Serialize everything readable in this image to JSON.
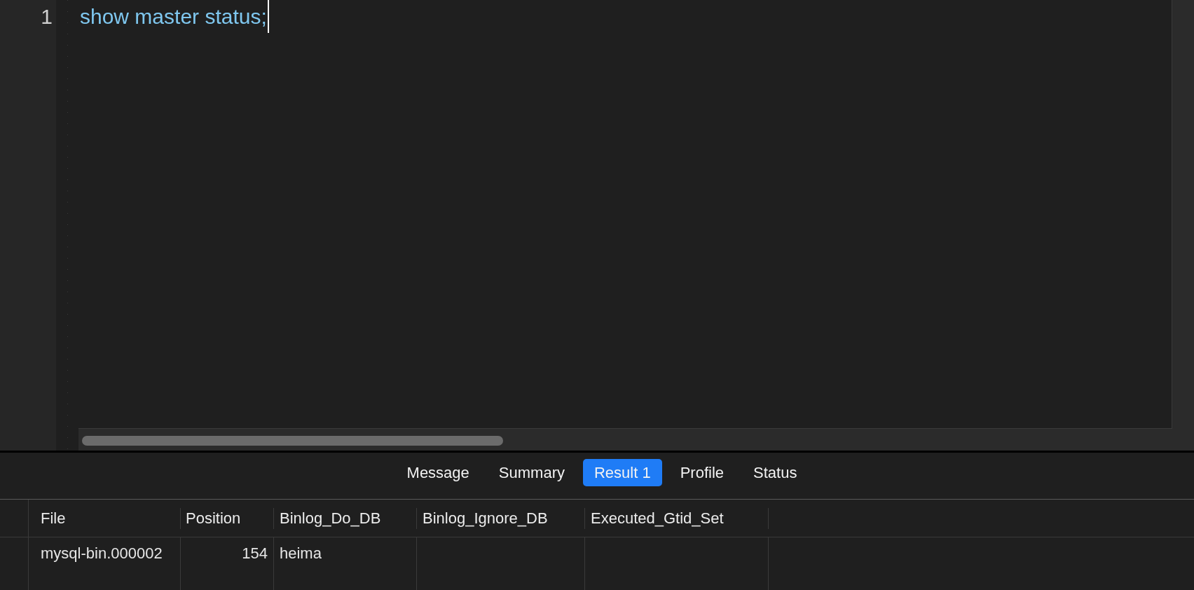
{
  "editor": {
    "lines": [
      {
        "number": "1",
        "code": "show master status;",
        "cursor": true
      }
    ]
  },
  "result_tabs": [
    {
      "label": "Message",
      "selected": false
    },
    {
      "label": "Summary",
      "selected": false
    },
    {
      "label": "Result 1",
      "selected": true
    },
    {
      "label": "Profile",
      "selected": false
    },
    {
      "label": "Status",
      "selected": false
    }
  ],
  "result_table": {
    "columns": [
      "File",
      "Position",
      "Binlog_Do_DB",
      "Binlog_Ignore_DB",
      "Executed_Gtid_Set"
    ],
    "rows": [
      {
        "cells": [
          "mysql-bin.000002",
          "154",
          "heima"
        ]
      }
    ]
  }
}
